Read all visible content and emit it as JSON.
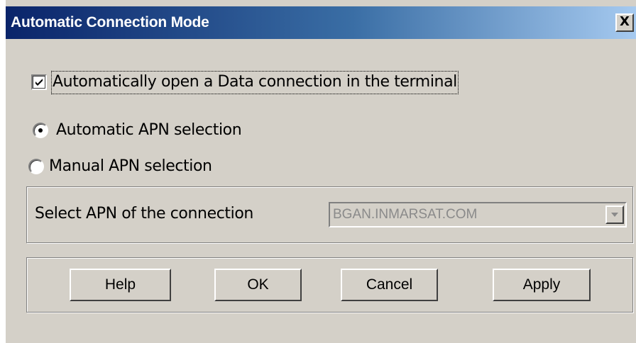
{
  "window": {
    "title": "Automatic Connection Mode",
    "close_label": "X"
  },
  "options": {
    "auto_open_label": "Automatically open a Data connection in the terminal",
    "auto_open_checked": true,
    "apn_mode_selected": "automatic",
    "automatic_apn_label": "Automatic APN selection",
    "manual_apn_label": "Manual APN selection"
  },
  "apn": {
    "label": "Select APN of the connection",
    "value": "BGAN.INMARSAT.COM",
    "enabled": false
  },
  "buttons": {
    "help": "Help",
    "ok": "OK",
    "cancel": "Cancel",
    "apply": "Apply"
  }
}
